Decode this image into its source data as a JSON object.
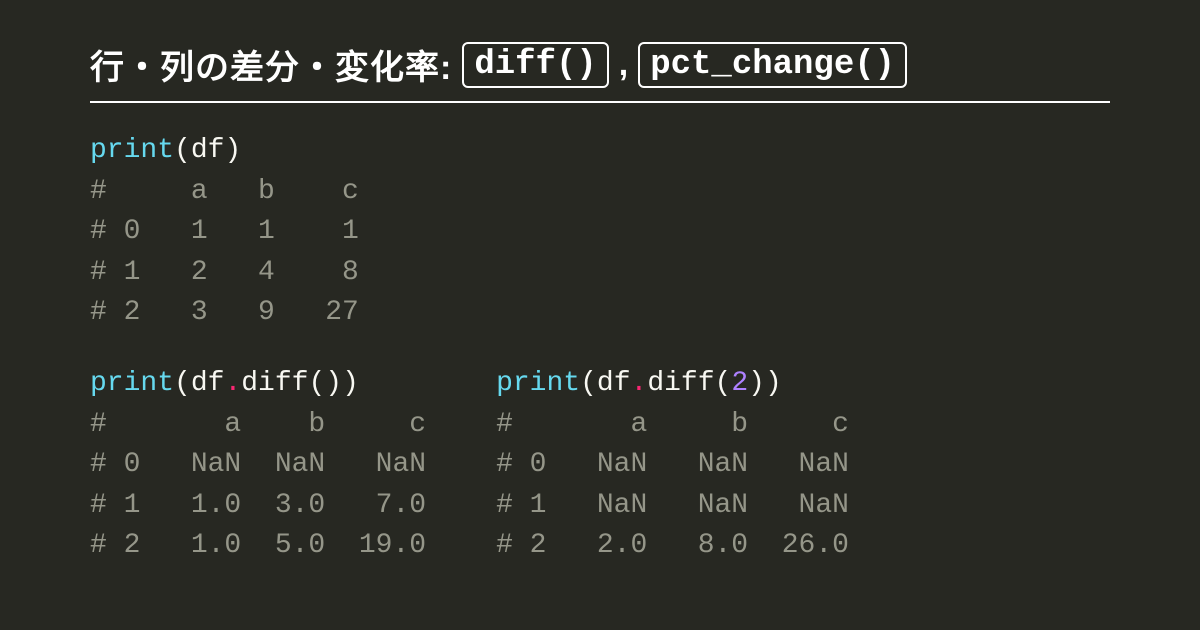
{
  "title": {
    "text": "行・列の差分・変化率:",
    "pill1": "diff()",
    "comma": ",",
    "pill2": "pct_change()"
  },
  "block1": {
    "fn": "print",
    "lp": "(",
    "arg": "df",
    "rp": ")",
    "out": "#     a   b    c\n# 0   1   1    1\n# 1   2   4    8\n# 2   3   9   27"
  },
  "block2": {
    "fn1": "print",
    "lp1": "(",
    "obj1": "df",
    "dot1": ".",
    "m1": "diff",
    "lp1b": "(",
    "rp1b": ")",
    "rp1": ")",
    "out1": "#       a    b     c\n# 0   NaN  NaN   NaN\n# 1   1.0  3.0   7.0\n# 2   1.0  5.0  19.0"
  },
  "block3": {
    "fn1": "print",
    "lp1": "(",
    "obj1": "df",
    "dot1": ".",
    "m1": "diff",
    "lp1b": "(",
    "arg": "2",
    "rp1b": ")",
    "rp1": ")",
    "out1": "#       a     b     c\n# 0   NaN   NaN   NaN\n# 1   NaN   NaN   NaN\n# 2   2.0   8.0  26.0"
  }
}
